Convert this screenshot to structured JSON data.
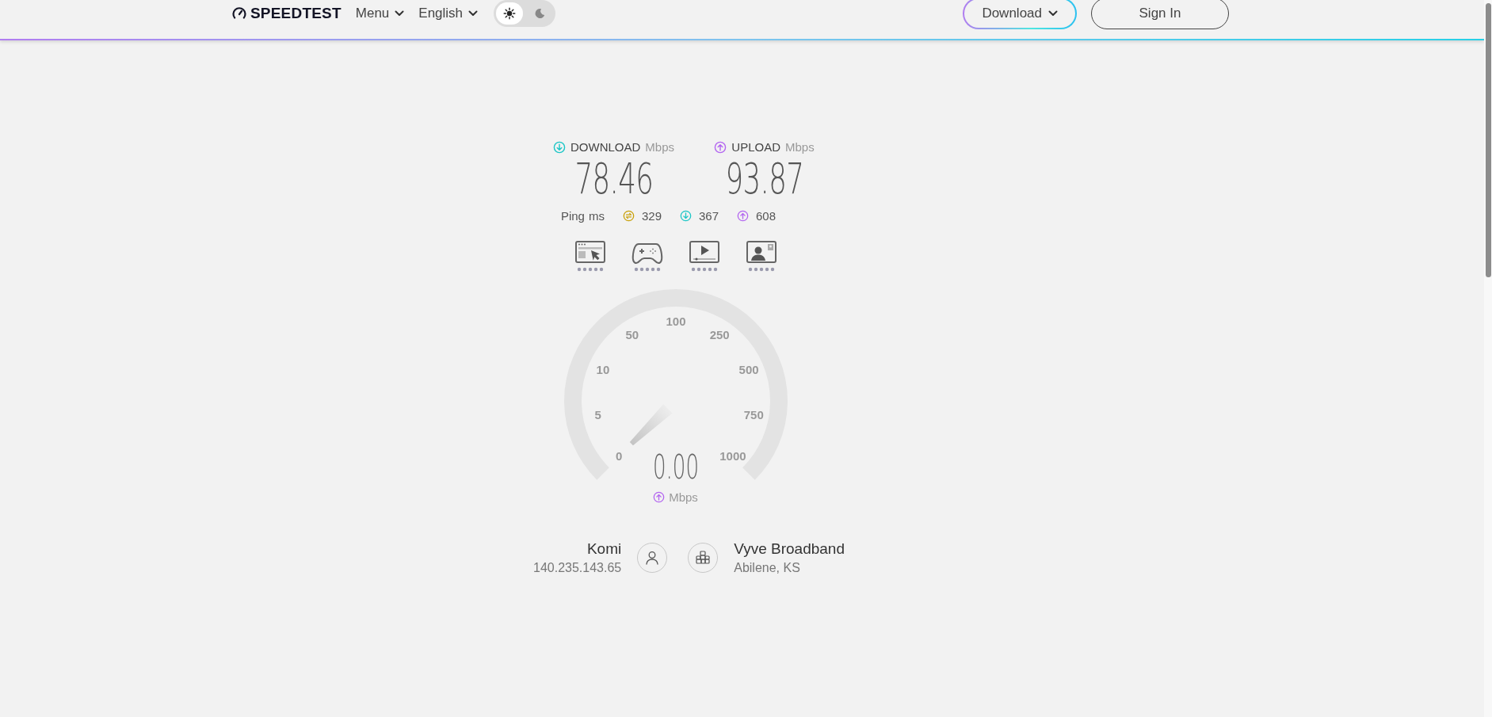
{
  "header": {
    "logo": "SPEEDTEST",
    "menu": "Menu",
    "language": "English",
    "theme_toggle": [
      {
        "kind": "light",
        "selected": true
      },
      {
        "kind": "dark",
        "selected": false
      }
    ],
    "download_button": "Download",
    "sign_in_button": "Sign In"
  },
  "results": [
    {
      "kind": "download",
      "label": "DOWNLOAD",
      "unit": "Mbps",
      "value": "78.46"
    },
    {
      "kind": "upload",
      "label": "UPLOAD",
      "unit": "Mbps",
      "value": "93.87"
    }
  ],
  "ping": {
    "label": "Ping",
    "unit": "ms",
    "readings": [
      {
        "kind": "idle",
        "value": "329"
      },
      {
        "kind": "download",
        "value": "367"
      },
      {
        "kind": "upload",
        "value": "608"
      }
    ]
  },
  "activities": [
    {
      "kind": "browsing"
    },
    {
      "kind": "gaming"
    },
    {
      "kind": "streaming"
    },
    {
      "kind": "video-call"
    }
  ],
  "gauge": {
    "ticks": [
      "0",
      "5",
      "10",
      "50",
      "100",
      "250",
      "500",
      "750",
      "1000"
    ],
    "reading": "0.00",
    "unit": {
      "kind": "upload",
      "label": "Mbps"
    }
  },
  "client": {
    "name": "Komi",
    "ip": "140.235.143.65"
  },
  "server": {
    "name": "Vyve Broadband",
    "location": "Abilene, KS"
  }
}
